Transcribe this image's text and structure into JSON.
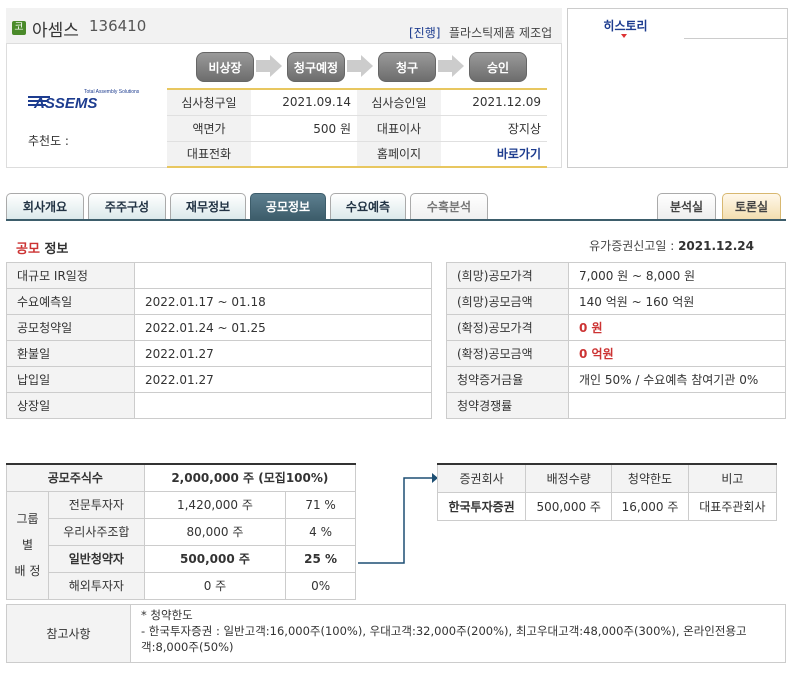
{
  "header": {
    "badge": "코",
    "company_name": "아셈스",
    "company_code": "136410",
    "status": "[진행]",
    "sector": "플라스틱제품 제조업",
    "logo_tagline": "Total Assembly Solutions",
    "logo_text": "ASSEMS",
    "recommend_label": "추천도 :",
    "steps": [
      "비상장",
      "청구예정",
      "청구",
      "승인"
    ],
    "info": {
      "review_request_label": "심사청구일",
      "review_request": "2021.09.14",
      "review_approval_label": "심사승인일",
      "review_approval": "2021.12.09",
      "par_label": "액면가",
      "par": "500 원",
      "ceo_label": "대표이사",
      "ceo": "장지상",
      "phone_label": "대표전화",
      "phone": "",
      "homepage_label": "홈페이지",
      "homepage": "바로가기"
    }
  },
  "history_tab": "히스토리",
  "tabs": [
    "회사개요",
    "주주구성",
    "재무정보",
    "공모정보",
    "수요예측",
    "수혹분석"
  ],
  "right_tabs": [
    "분석실",
    "토론실"
  ],
  "section": {
    "title_red": "공모",
    "title": " 정보",
    "filing_label": "유가증권신고일 :",
    "filing_date": "2021.12.24"
  },
  "schedule": [
    {
      "label": "대규모 IR일정",
      "value": ""
    },
    {
      "label": "수요예측일",
      "value": "2022.01.17 ~ 01.18"
    },
    {
      "label": "공모청약일",
      "value": "2022.01.24 ~ 01.25"
    },
    {
      "label": "환불일",
      "value": "2022.01.27"
    },
    {
      "label": "납입일",
      "value": "2022.01.27"
    },
    {
      "label": "상장일",
      "value": ""
    }
  ],
  "pricing": [
    {
      "label": "(희망)공모가격",
      "value": "7,000 원 ~ 8,000 원"
    },
    {
      "label": "(희망)공모금액",
      "value": "140 억원  ~ 160 억원"
    },
    {
      "label": "(확정)공모가격",
      "value": "0 원"
    },
    {
      "label": "(확정)공모금액",
      "value": "0 억원"
    },
    {
      "label": "청약증거금율",
      "value": "개인 50% / 수요예측 참여기관 0%"
    },
    {
      "label": "청약경쟁률",
      "value": ""
    }
  ],
  "shares": {
    "total_label": "공모주식수",
    "total_value": "2,000,000  주 (모집100%)",
    "group_label_1": "그룹별",
    "group_label_2": "배 정",
    "rows": [
      {
        "label": "전문투자자",
        "shares": "1,420,000 주",
        "pct": "71 %"
      },
      {
        "label": "우리사주조합",
        "shares": "80,000 주",
        "pct": "4 %"
      },
      {
        "label": "일반청약자",
        "shares": "500,000  주",
        "pct": "25 %"
      },
      {
        "label": "해외투자자",
        "shares": "0 주",
        "pct": "0%"
      }
    ]
  },
  "underwriters": {
    "headers": [
      "증권회사",
      "배정수량",
      "청약한도",
      "비고"
    ],
    "rows": [
      {
        "name": "한국투자증권",
        "alloc": "500,000 주",
        "limit": "16,000 주",
        "note": "대표주관회사"
      }
    ]
  },
  "note": {
    "label": "참고사항",
    "line1": "* 청약한도",
    "line2": "- 한국투자증권 : 일반고객:16,000주(100%), 우대고객:32,000주(200%), 최고우대고객:48,000주(300%), 온라인전용고",
    "line3": "객:8,000주(50%)"
  }
}
